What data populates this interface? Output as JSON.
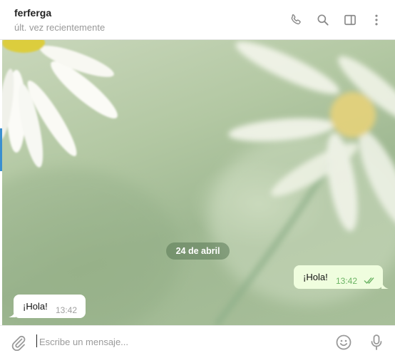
{
  "header": {
    "title": "ferferga",
    "status": "últ. vez recientemente",
    "icons": [
      "phone-icon",
      "search-icon",
      "sidebar-icon",
      "more-vertical-icon"
    ]
  },
  "chat": {
    "date_separator": "24 de abril",
    "messages": [
      {
        "direction": "outgoing",
        "text": "¡Hola!",
        "time": "13:42",
        "status": "read"
      },
      {
        "direction": "incoming",
        "text": "¡Hola!",
        "time": "13:42"
      }
    ]
  },
  "composer": {
    "placeholder": "Escribe un mensaje...",
    "value": "",
    "icons": [
      "attach-icon",
      "emoji-icon",
      "microphone-icon"
    ]
  },
  "colors": {
    "outgoing_bubble": "#effdde",
    "incoming_bubble": "#ffffff",
    "read_checks": "#6cb465",
    "icon_gray": "#8a8a8a",
    "accent": "#3a8fd0"
  }
}
